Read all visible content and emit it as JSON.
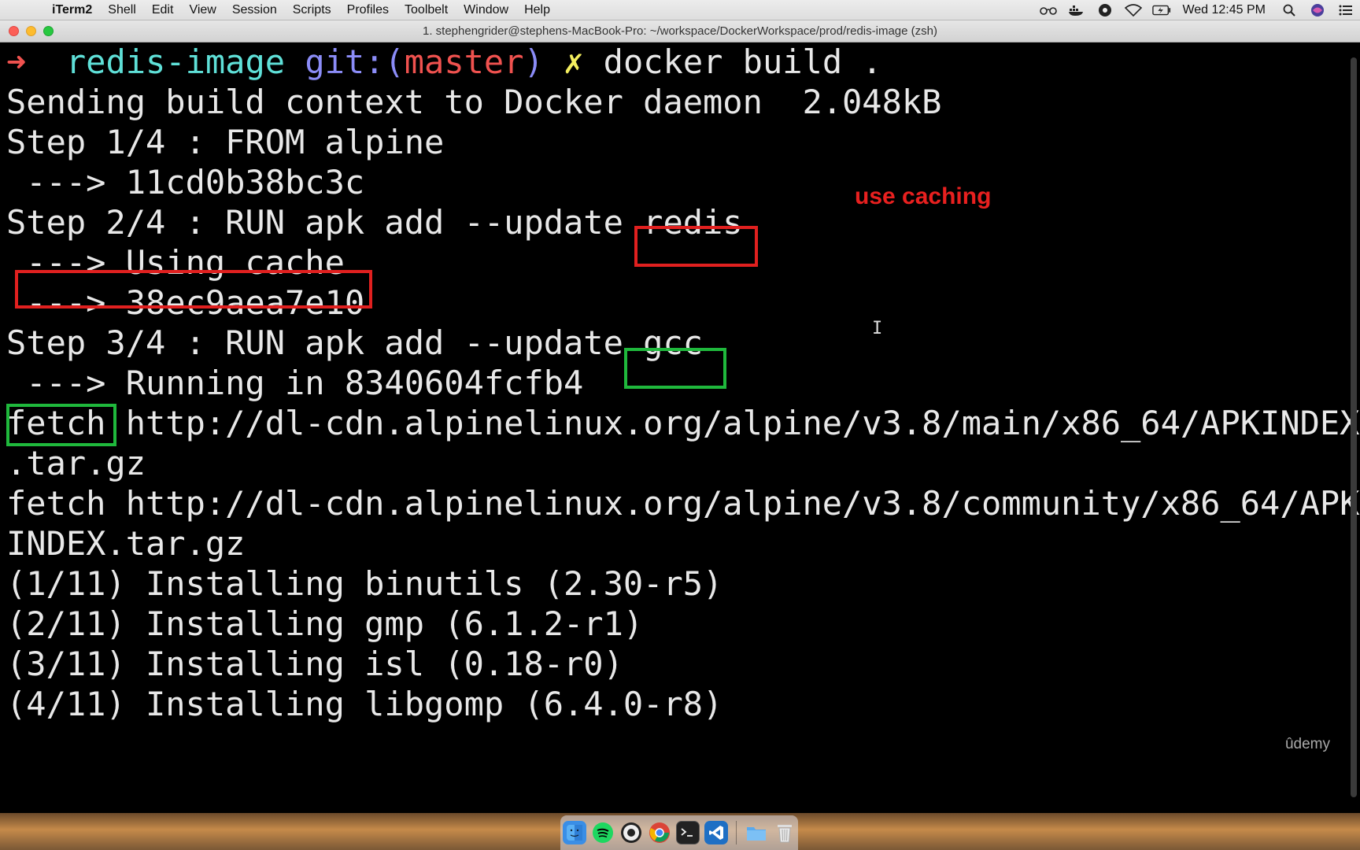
{
  "menubar": {
    "app_name": "iTerm2",
    "items": [
      "Shell",
      "Edit",
      "View",
      "Session",
      "Scripts",
      "Profiles",
      "Toolbelt",
      "Window",
      "Help"
    ],
    "clock": "Wed 12:45 PM"
  },
  "window": {
    "title": "1. stephengrider@stephens-MacBook-Pro: ~/workspace/DockerWorkspace/prod/redis-image (zsh)"
  },
  "prompt": {
    "arrow": "➜",
    "dir": "redis-image",
    "git_label": "git:(",
    "branch": "master",
    "git_close": ")",
    "dirty": "✗",
    "command": "docker build ."
  },
  "lines": [
    "Sending build context to Docker daemon  2.048kB",
    "Step 1/4 : FROM alpine",
    " ---> 11cd0b38bc3c",
    "Step 2/4 : RUN apk add --update redis",
    " ---> Using cache",
    " ---> 38ec9aea7e10",
    "Step 3/4 : RUN apk add --update gcc",
    " ---> Running in 8340604fcfb4",
    "fetch http://dl-cdn.alpinelinux.org/alpine/v3.8/main/x86_64/APKINDEX",
    ".tar.gz",
    "fetch http://dl-cdn.alpinelinux.org/alpine/v3.8/community/x86_64/APK",
    "INDEX.tar.gz",
    "(1/11) Installing binutils (2.30-r5)",
    "(2/11) Installing gmp (6.1.2-r1)",
    "(3/11) Installing isl (0.18-r0)",
    "(4/11) Installing libgomp (6.4.0-r8)"
  ],
  "annotation": "use caching",
  "watermark": "ûdemy",
  "cursor": "I",
  "colors": {
    "annotation_red": "#e0201f",
    "annotation_green": "#1fb83c",
    "prompt_arrow": "#f0524f",
    "prompt_dir": "#5fe0d8"
  },
  "dock": {
    "icons": [
      "finder-icon",
      "spotify-icon",
      "obs-icon",
      "chrome-icon",
      "terminal-icon",
      "vscode-icon",
      "folder-icon",
      "trash-icon"
    ]
  }
}
